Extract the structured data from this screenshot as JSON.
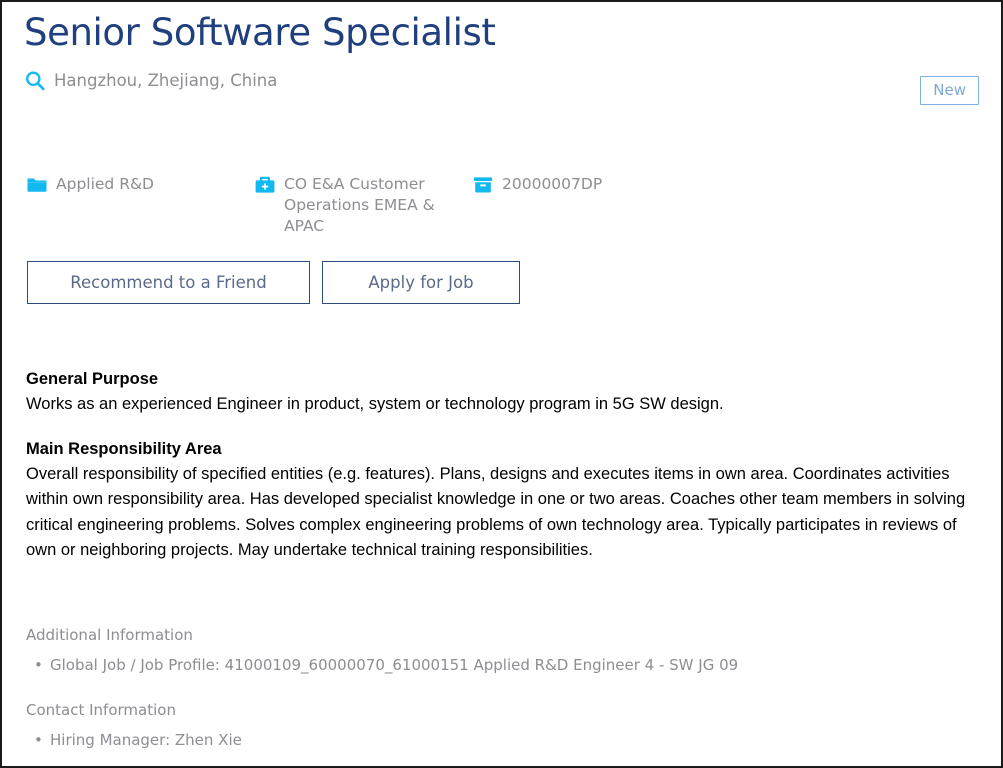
{
  "page": {
    "title": "Senior Software Specialist",
    "location": "Hangzhou, Zhejiang, China",
    "search_icon": "search-icon"
  },
  "badge": {
    "label": "New",
    "border_color": "#7fb2e0",
    "text_color": "#7fa8d4"
  },
  "meta": [
    {
      "icon": "folder-icon",
      "text": "Applied R&D"
    },
    {
      "icon": "briefcase-icon",
      "text": "CO E&A Customer Operations EMEA & APAC"
    },
    {
      "icon": "archive-box-icon",
      "text": "20000007DP"
    }
  ],
  "actions": {
    "recommend_label": "Recommend to a Friend",
    "apply_label": "Apply for Job"
  },
  "sections": [
    {
      "heading": "General Purpose",
      "body": "Works as an experienced Engineer in product, system or technology program in 5G SW design."
    },
    {
      "heading": "Main Responsibility Area",
      "body": "Overall responsibility of specified entities (e.g. features). Plans, designs and executes items in own area. Coordinates activities within own responsibility area. Has developed specialist knowledge in one or two areas. Coaches other team members in solving critical engineering problems. Solves complex engineering problems of own technology area. Typically participates in reviews of own or neighboring projects. May undertake technical training responsibilities."
    }
  ],
  "additional_information": {
    "label": "Additional Information",
    "items": [
      "Global Job / Job Profile: 41000109_60000070_61000151 Applied R&D Engineer 4 - SW JG 09"
    ]
  },
  "contact_information": {
    "label": "Contact Information",
    "items": [
      "Hiring Manager: Zhen Xie"
    ]
  },
  "colors": {
    "title": "#1f3f7e",
    "accent_cyan": "#12b9f0",
    "muted_text": "#8d8d93",
    "button_border": "#2b4a7d",
    "button_text": "#5a6a8a"
  }
}
